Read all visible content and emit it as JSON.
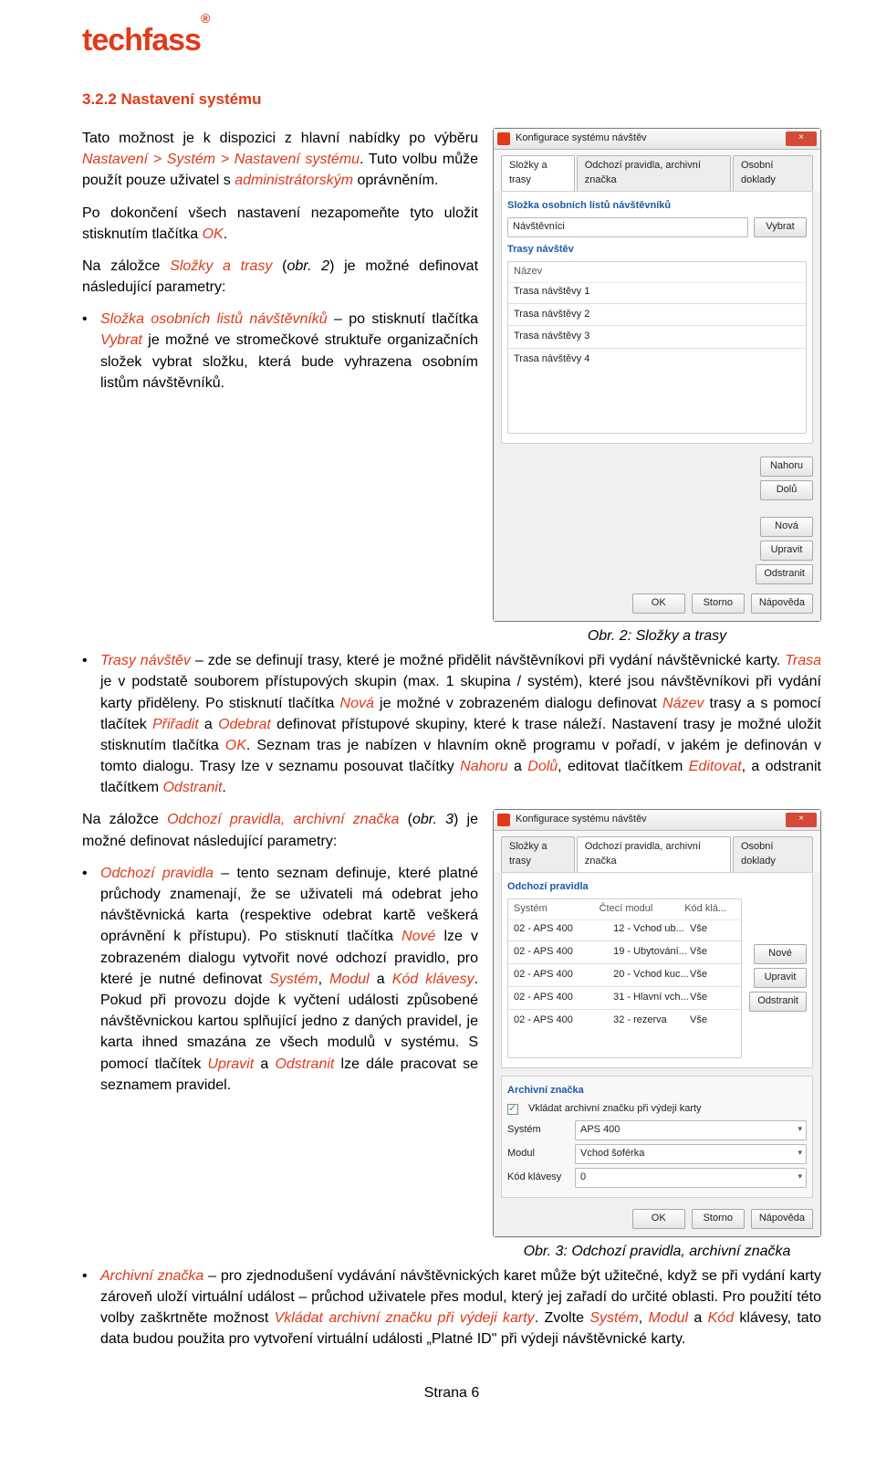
{
  "logo": "techfass",
  "logo_reg": "®",
  "heading": "3.2.2  Nastavení systému",
  "sec1": {
    "p1_a": "Tato možnost je k dispozici z hlavní nabídky po výběru ",
    "p1_menu": "Nastavení > Systém > Nastavení systému",
    "p1_b": ". Tuto volbu může použít pouze uživatel s ",
    "p1_role": "administrátorským",
    "p1_c": " oprávněním.",
    "p2_a": "Po dokončení všech nastavení nezapomeňte tyto uložit stisknutím tlačítka ",
    "p2_ok": "OK",
    "p2_b": ".",
    "p3_a": "Na záložce ",
    "p3_tab": "Složky a trasy",
    "p3_b": " (",
    "p3_obr": "obr. 2",
    "p3_c": ") je možné definovat následující parametry:",
    "b1_a": "Složka osobních listů návštěvníků",
    "b1_b": " – po stisknutí tlačítka ",
    "b1_vybrat": "Vybrat",
    "b1_c": " je možné ve stromečkové struktuře organizačních složek vybrat složku, která bude vyhrazena osobním listům návštěvníků.",
    "b2_a": "Trasy návštěv",
    "b2_b": " – zde se definují trasy, které je možné přidělit návštěvníkovi při vydání návštěvnické karty. ",
    "b2_trasa": "Trasa",
    "b2_c": " je v podstatě souborem přístupových skupin (max. 1 skupina / systém), které jsou návštěvníkovi při vydání karty přiděleny. Po stisknutí tlačítka ",
    "b2_nova": "Nová",
    "b2_d": " je možné v zobrazeném dialogu definovat ",
    "b2_nazev": "Název",
    "b2_e": " trasy a s pomocí tlačítek ",
    "b2_priradit": "Přiřadit",
    "b2_f": " a ",
    "b2_odebrat": "Odebrat",
    "b2_g": " definovat přístupové skupiny, které k trase náleží. Nastavení trasy je možné uložit stisknutím tlačítka ",
    "b2_ok": "OK",
    "b2_h": ". Seznam tras je nabízen v hlavním okně programu v pořadí, v jakém je definován v tomto dialogu. Trasy lze v seznamu posouvat tlačítky ",
    "b2_nahoru": "Nahoru",
    "b2_i": " a ",
    "b2_dolu": "Dolů",
    "b2_j": ", editovat tlačítkem ",
    "b2_edit": "Editovat",
    "b2_k": ", a odstranit tlačítkem ",
    "b2_odstr": "Odstranit",
    "b2_l": ".",
    "caption1": "Obr. 2: Složky a trasy"
  },
  "sec2": {
    "p1_a": "Na záložce ",
    "p1_tab": "Odchozí pravidla, archivní značka",
    "p1_b": " (",
    "p1_obr": "obr. 3",
    "p1_c": ") je možné definovat následující parametry:",
    "b1_a": "Odchozí pravidla",
    "b1_b": " – tento seznam definuje, které platné průchody znamenají, že se uživateli má odebrat jeho návštěvnická karta (respektive odebrat kartě veškerá oprávnění k přístupu). Po stisknutí tlačítka ",
    "b1_nove": "Nové",
    "b1_c": " lze v zobrazeném dialogu vytvořit nové odchozí pravidlo, pro které je nutné definovat ",
    "b1_system": "Systém",
    "b1_d": ", ",
    "b1_modul": "Modul",
    "b1_e": " a ",
    "b1_kod": "Kód klávesy",
    "b1_f": ". Pokud při provozu dojde k vyčtení události způsobené návštěvnickou kartou splňující jedno z daných pravidel, je karta ihned smazána ze všech modulů v systému. S pomocí tlačítek ",
    "b1_upravit": "Upravit",
    "b1_g": " a ",
    "b1_odstranit": "Odstranit",
    "b1_h": " lze dále pracovat se seznamem pravidel.",
    "b2_a": "Archivní značka",
    "b2_b": " – pro zjednodušení vydávání návštěvnických karet může být užitečné, když se při vydání karty zároveň uloží virtuální událost – průchod uživatele přes modul, který jej zařadí do určité oblasti. Pro použití této volby zaškrtněte možnost ",
    "b2_vkladat": "Vkládat archivní značku při výdeji karty",
    "b2_c": ". Zvolte ",
    "b2_system": "Systém",
    "b2_d": ", ",
    "b2_modul": "Modul",
    "b2_e": " a ",
    "b2_kod": "Kód",
    "b2_f": " klávesy, tato data budou použita pro vytvoření virtuální události „Platné ID\" při výdeji návštěvnické karty.",
    "caption2": "Obr. 3: Odchozí pravidla, archivní značka"
  },
  "dlg1": {
    "title": "Konfigurace systému návštěv",
    "tabs": [
      "Složky a trasy",
      "Odchozí pravidla, archivní značka",
      "Osobní doklady"
    ],
    "sect1": "Složka osobních listů návštěvníků",
    "field1": "Návštěvníci",
    "vybrat": "Vybrat",
    "sect2": "Trasy návštěv",
    "col": "Název",
    "rows": [
      "Trasa návštěvy 1",
      "Trasa návštěvy 2",
      "Trasa návštěvy 3",
      "Trasa návštěvy 4"
    ],
    "btns": {
      "nahoru": "Nahoru",
      "dolu": "Dolů",
      "nova": "Nová",
      "upravit": "Upravit",
      "odstranit": "Odstranit"
    },
    "ok": "OK",
    "storno": "Storno",
    "napoveda": "Nápověda"
  },
  "dlg2": {
    "title": "Konfigurace systému návštěv",
    "tabs": [
      "Složky a trasy",
      "Odchozí pravidla, archivní značka",
      "Osobní doklady"
    ],
    "sect1": "Odchozí pravidla",
    "cols": [
      "Systém",
      "Čtecí modul",
      "Kód klá..."
    ],
    "rows": [
      [
        "02 - APS 400",
        "12 - Vchod ub...",
        "Vše"
      ],
      [
        "02 - APS 400",
        "19 - Ubytování...",
        "Vše"
      ],
      [
        "02 - APS 400",
        "20 - Vchod kuc...",
        "Vše"
      ],
      [
        "02 - APS 400",
        "31 - Hlavní vch...",
        "Vše"
      ],
      [
        "02 - APS 400",
        "32 - rezerva",
        "Vše"
      ]
    ],
    "btns": {
      "nove": "Nové",
      "upravit": "Upravit",
      "odstranit": "Odstranit"
    },
    "sect2": "Archivní značka",
    "chk": "Vkládat archivní značku při výdeji karty",
    "lblSystem": "Systém",
    "valSystem": "APS 400",
    "lblModul": "Modul",
    "valModul": "Vchod šoférka",
    "lblKod": "Kód klávesy",
    "valKod": "0",
    "ok": "OK",
    "storno": "Storno",
    "napoveda": "Nápověda"
  },
  "footer": "Strana 6"
}
